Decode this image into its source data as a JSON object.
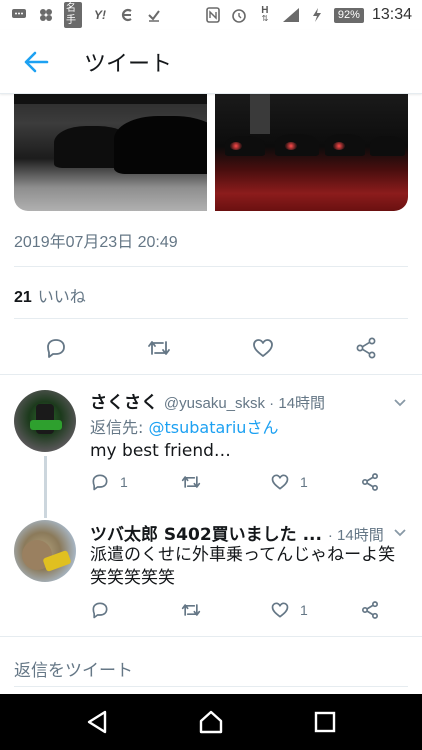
{
  "status_bar": {
    "left_icons": [
      "message-icon",
      "apps-icon",
      "meishi-icon",
      "yahoo-icon",
      "e-icon",
      "check-icon"
    ],
    "meishi_label": "名手",
    "yahoo_label": "Y!",
    "right_icons": [
      "nfc-icon",
      "alarm-icon",
      "hplus-icon",
      "signal-icon",
      "charging-icon"
    ],
    "hplus_label": "H",
    "battery": "92%",
    "time": "13:34"
  },
  "header": {
    "title": "ツイート"
  },
  "tweet": {
    "date": "2019年07月23日 20:49",
    "likes_count": "21",
    "likes_label": "いいね"
  },
  "replies": [
    {
      "name": "さくさく",
      "handle": "@yusaku_sksk · 14時間",
      "reply_to_prefix": "返信先: ",
      "reply_to_handle": "@tsubatariuさん",
      "text": "my best friend…",
      "reply_count": "1",
      "retweet_count": "",
      "like_count": "1"
    },
    {
      "name": "ツバ太郎 S402買いました ...",
      "handle": "· 14時間",
      "text": "派遣のくせに外車乗ってんじゃねーよ笑笑笑笑笑笑",
      "reply_count": "",
      "retweet_count": "",
      "like_count": "1"
    }
  ],
  "reply_input": {
    "placeholder": "返信をツイート"
  },
  "colors": {
    "accent": "#1da1f2",
    "secondary_text": "#657786",
    "primary_text": "#14171a"
  }
}
